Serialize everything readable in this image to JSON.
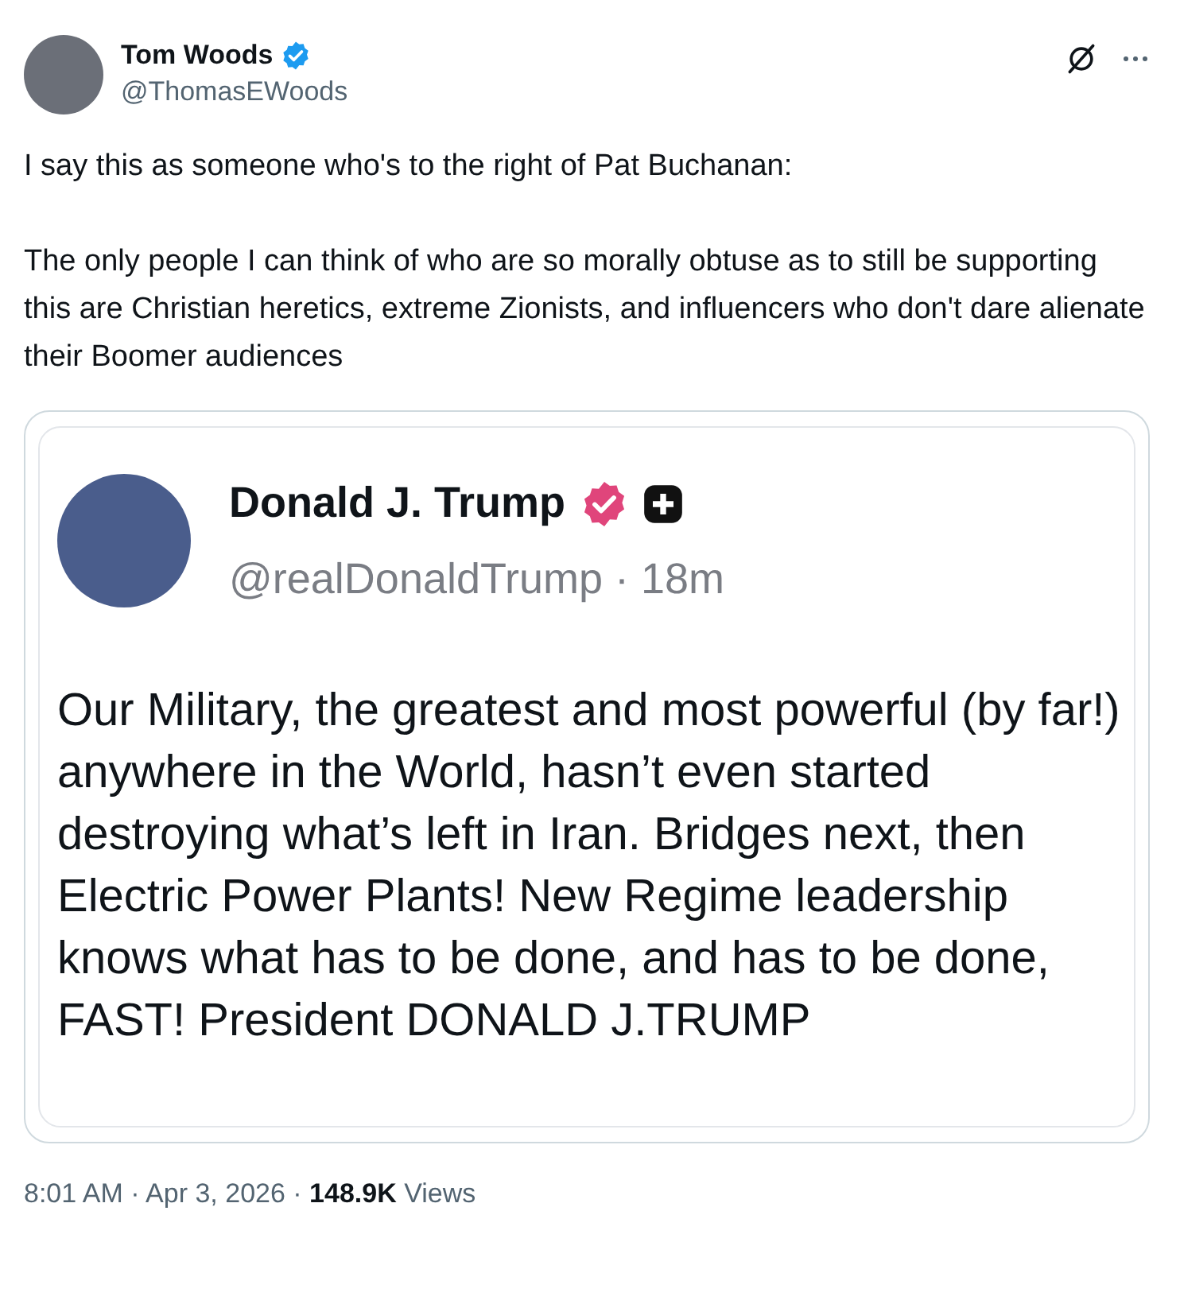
{
  "author": {
    "name": "Tom Woods",
    "verified": true,
    "handle": "@ThomasEWoods"
  },
  "paragraphs": [
    "I say this as someone who's to the right of Pat Buchanan:",
    "The only people I can think of who are so morally obtuse as to still be supporting this are Christian heretics, extreme Zionists, and influencers who don't dare alienate their Boomer audiences"
  ],
  "embedded_post": {
    "name": "Donald J. Trump",
    "verified": true,
    "handle": "@realDonaldTrump · 18m",
    "text": "Our Military, the greatest and most powerful (by far!) anywhere in the World, hasn’t even started destroying what’s left in Iran. Bridges next, then Electric Power Plants! New Regime leadership knows what has to be done, and has to be done, FAST! President DONALD J.TRUMP"
  },
  "footer": "8:01 AM · Apr 3, 2026 · **148.9K** Views"
}
